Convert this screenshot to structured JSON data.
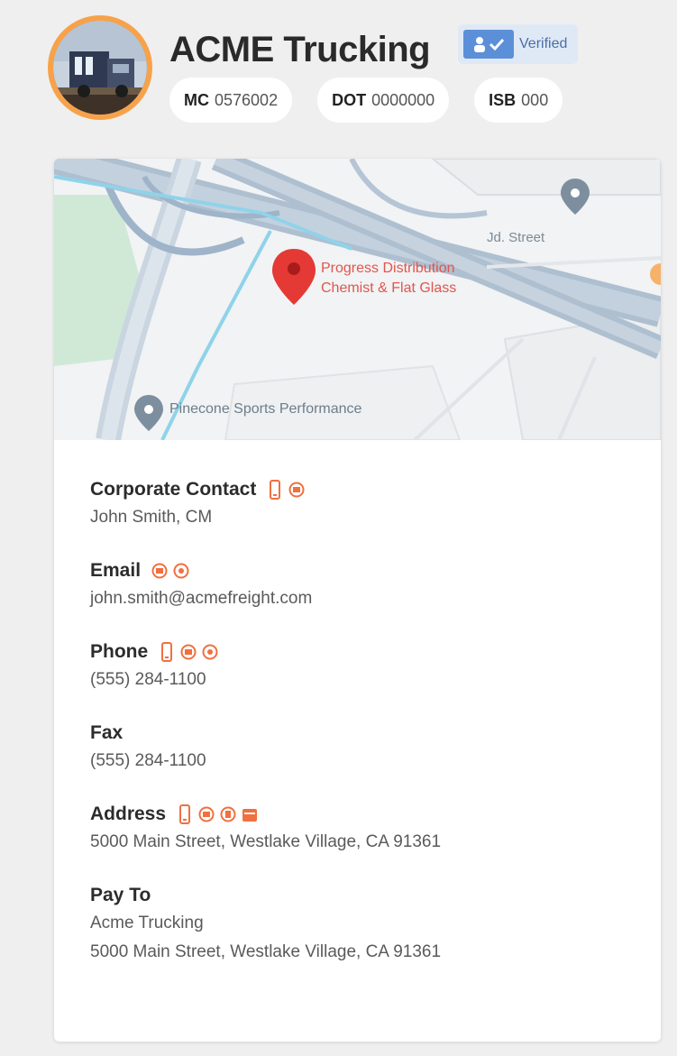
{
  "company": {
    "name": "ACME Trucking",
    "verified_label": "Verified",
    "verified_icon": "verified-user-icon"
  },
  "ids": [
    {
      "label": "MC",
      "value": "0576002"
    },
    {
      "label": "DOT",
      "value": "0000000"
    },
    {
      "label": "ISB",
      "value": "000"
    }
  ],
  "map": {
    "pin_label_line1": "Progress Distribution",
    "pin_label_line2": "Chemist & Flat Glass",
    "poi_label": "Pinecone Sports Performance",
    "street_label": "Jd. Street"
  },
  "contact": {
    "corporate_contact": {
      "label": "Corporate Contact",
      "value": "John Smith, CM"
    },
    "email": {
      "label": "Email",
      "value": "john.smith@acmefreight.com"
    },
    "phone": {
      "label": "Phone",
      "value": "(555) 284-1100"
    },
    "fax": {
      "label": "Fax",
      "value": "(555) 284-1100"
    },
    "address": {
      "label": "Address",
      "value": "5000 Main Street, Westlake Village, CA 91361"
    },
    "pay_to": {
      "label": "Pay To",
      "name": "Acme Trucking",
      "address": "5000 Main Street, Westlake Village, CA 91361"
    }
  },
  "colors": {
    "accent": "#f07040",
    "avatar_ring": "#f7a24a",
    "verified_bg": "#dfe9f5",
    "map_pin": "#e53935"
  }
}
